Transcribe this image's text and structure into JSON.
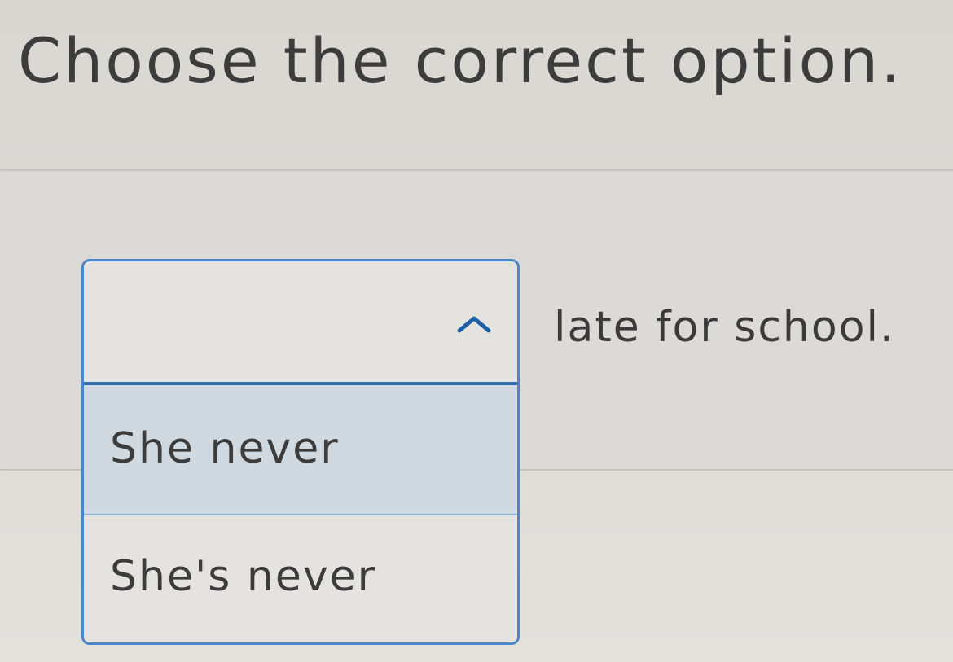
{
  "instruction": "Choose the correct option.",
  "question": {
    "sentence_after_blank": "late for school."
  },
  "dropdown": {
    "selected_value": "",
    "expanded": true,
    "toggle_icon": "chevron-up-icon",
    "accent_color": "#2e6fb6",
    "highlight_color": "#cfd9df",
    "options": [
      {
        "label": "She never",
        "highlighted": true
      },
      {
        "label": "She's never",
        "highlighted": false
      }
    ]
  }
}
